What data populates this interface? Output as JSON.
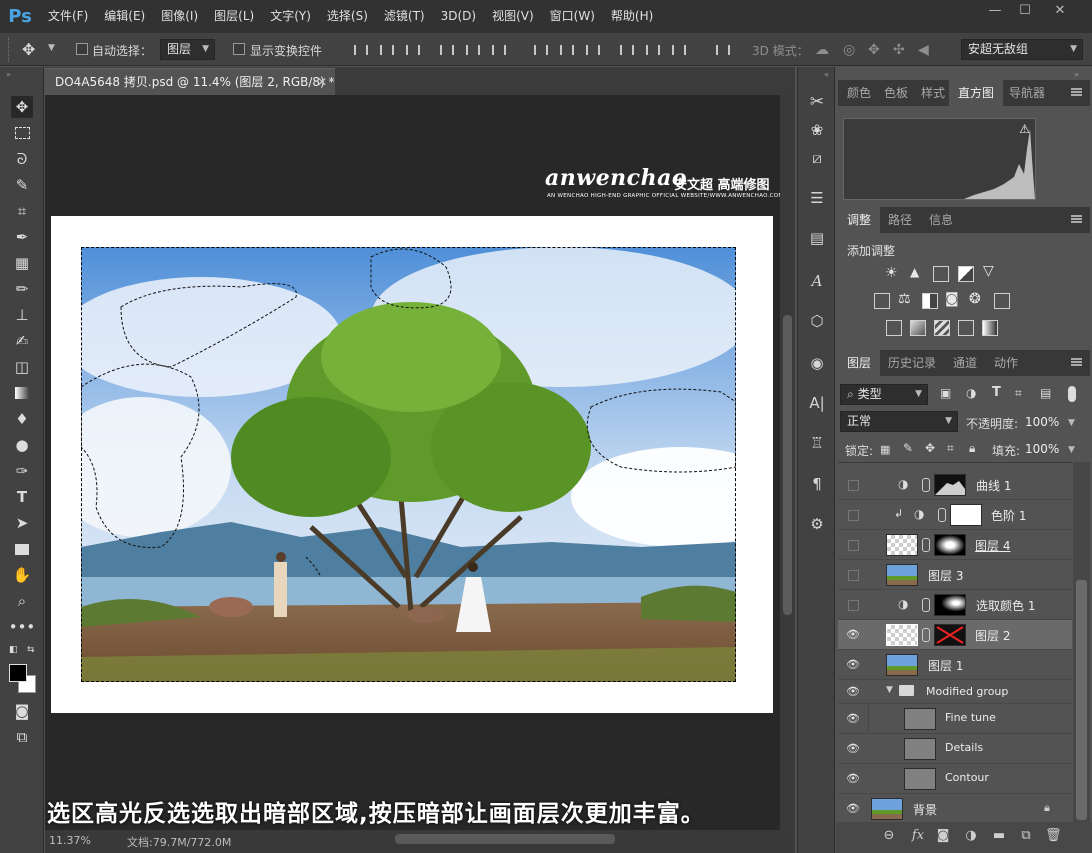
{
  "app": {
    "logo": "Ps",
    "menu": [
      "文件(F)",
      "编辑(E)",
      "图像(I)",
      "图层(L)",
      "文字(Y)",
      "选择(S)",
      "滤镜(T)",
      "3D(D)",
      "视图(V)",
      "窗口(W)",
      "帮助(H)"
    ]
  },
  "options": {
    "auto_select_label": "自动选择：",
    "auto_select_value": "图层",
    "show_transform_label": "显示变换控件",
    "mode_3d_label": "3D 模式：",
    "workspace_value": "安超无敌组"
  },
  "document": {
    "tab_title": "DO4A5648 拷贝.psd @ 11.4% (图层 2, RGB/8) *",
    "zoom": "11.37%",
    "doc_size": "文档:79.7M/772.0M"
  },
  "watermark": {
    "logo": "anwenchao",
    "cn": "安文超 高端修图",
    "sub": "AN WENCHAO HIGH-END GRAPHIC OFFICIAL WEBSITE/WWW.ANWENCHAO.COM"
  },
  "caption": "选区高光反选选取出暗部区域,按压暗部让画面层次更加丰富。",
  "top_panel": {
    "tabs": [
      "颜色",
      "色板",
      "样式",
      "直方图",
      "导航器"
    ],
    "active": "直方图"
  },
  "adjust_panel": {
    "tabs": [
      "调整",
      "路径",
      "信息"
    ],
    "active": "调整",
    "title": "添加调整"
  },
  "layers_panel": {
    "tabs": [
      "图层",
      "历史记录",
      "通道",
      "动作"
    ],
    "active": "图层",
    "filter_kind": "类型",
    "blend_mode": "正常",
    "opacity_label": "不透明度:",
    "opacity_value": "100%",
    "lock_label": "锁定:",
    "fill_label": "填充:",
    "fill_value": "100%",
    "layers": [
      {
        "name": "曲线 1",
        "visible": false,
        "type": "adjustment",
        "mask": "curves"
      },
      {
        "name": "色阶 1",
        "visible": false,
        "type": "adjustment",
        "mask": "white",
        "clipped": true
      },
      {
        "name": "图层 4",
        "visible": false,
        "type": "pixel",
        "mask": "dark"
      },
      {
        "name": "图层 3",
        "visible": false,
        "type": "pixel"
      },
      {
        "name": "选取颜色 1",
        "visible": false,
        "type": "adjustment",
        "mask": "dark"
      },
      {
        "name": "图层 2",
        "visible": true,
        "type": "pixel",
        "mask": "disabled",
        "selected": true
      },
      {
        "name": "图层 1",
        "visible": true,
        "type": "pixel"
      },
      {
        "name": "Modified group",
        "visible": true,
        "type": "group"
      },
      {
        "name": "Fine tune",
        "visible": true,
        "type": "child"
      },
      {
        "name": "Details",
        "visible": true,
        "type": "child"
      },
      {
        "name": "Contour",
        "visible": true,
        "type": "child"
      },
      {
        "name": "背景",
        "visible": true,
        "type": "background",
        "locked": true
      }
    ]
  },
  "colors": {
    "bg": "#535353",
    "accent": "#4aa3e3",
    "selected_layer": "#6a6a6a"
  }
}
